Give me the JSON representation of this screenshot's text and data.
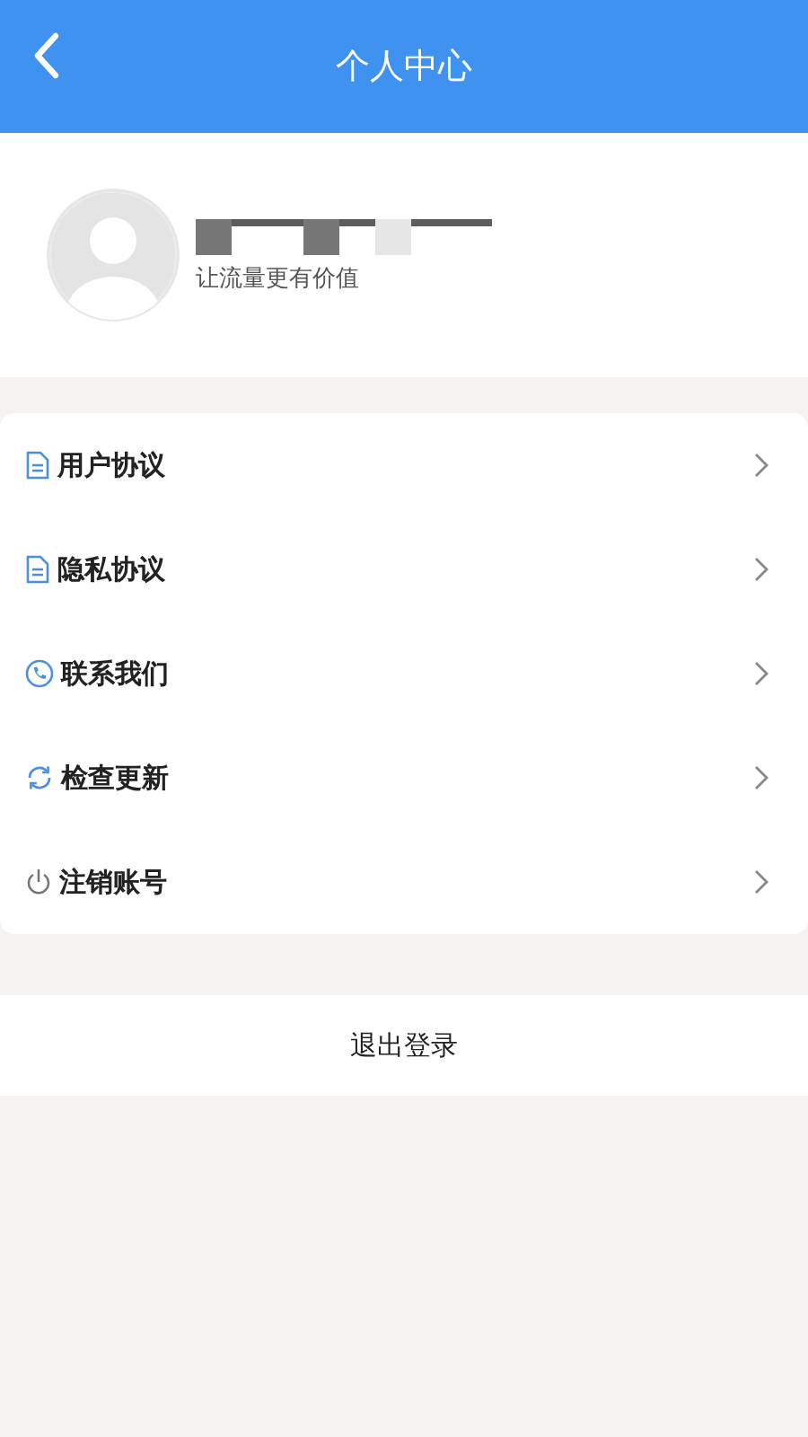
{
  "header": {
    "title": "个人中心"
  },
  "profile": {
    "slogan": "让流量更有价值"
  },
  "menu": [
    {
      "kind": "document",
      "label": "用户协议"
    },
    {
      "kind": "document",
      "label": "隐私协议"
    },
    {
      "kind": "phone",
      "label": "联系我们"
    },
    {
      "kind": "refresh",
      "label": "检查更新"
    },
    {
      "kind": "power",
      "label": "注销账号"
    }
  ],
  "logout": "退出登录"
}
